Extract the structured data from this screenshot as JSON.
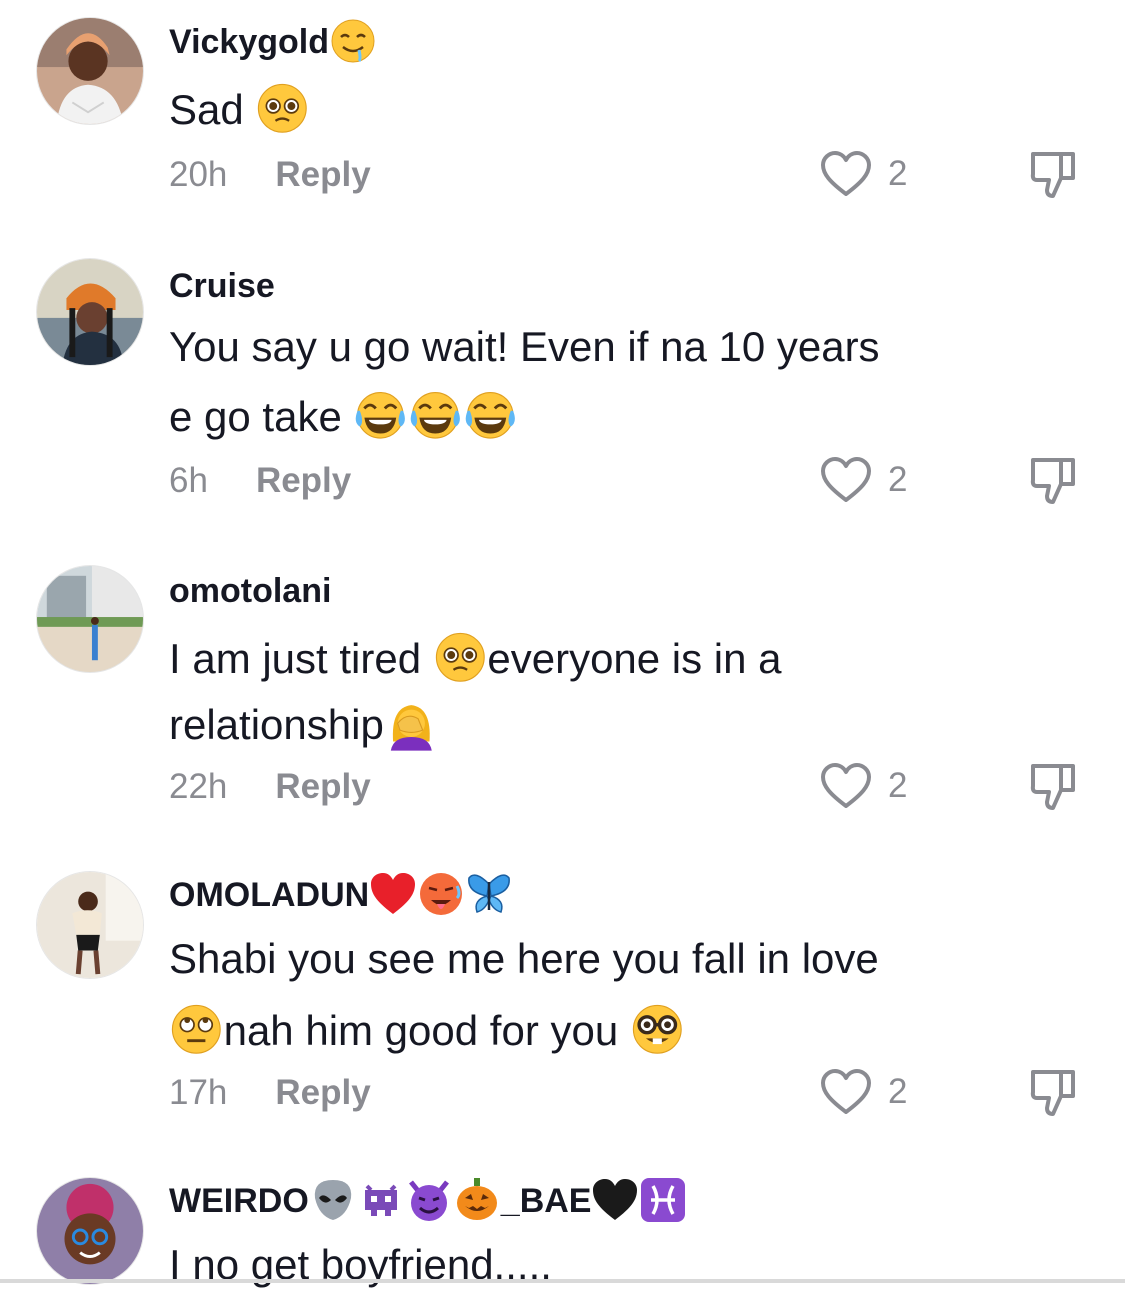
{
  "comments": [
    {
      "username": "Vickygold",
      "username_emojis": [
        "drooling-face"
      ],
      "text_parts": [
        "Sad "
      ],
      "text_emojis_after": [
        "pleading-face"
      ],
      "time": "20h",
      "reply_label": "Reply",
      "likes": "2"
    },
    {
      "username": "Cruise",
      "text_line1": "You say u go wait! Even if na 10 years",
      "text_line2": "e go take ",
      "text_emojis_after": [
        "tears-of-joy",
        "tears-of-joy",
        "tears-of-joy"
      ],
      "time": "6h",
      "reply_label": "Reply",
      "likes": "2"
    },
    {
      "username": "omotolani",
      "text_before": "I am just tired ",
      "text_after": "everyone is in a",
      "text_line2": "relationship",
      "emojis": [
        "pleading-face",
        "woman-facepalming"
      ],
      "time": "22h",
      "reply_label": "Reply",
      "likes": "2"
    },
    {
      "username": "OMOLADUN",
      "username_emojis": [
        "red-heart",
        "hot-face",
        "butterfly"
      ],
      "text_line1": "Shabi you see me here you fall in love",
      "text_line2a": "nah him good for you ",
      "emojis": [
        "rolling-eyes",
        "nerd-face"
      ],
      "time": "17h",
      "reply_label": "Reply",
      "likes": "2"
    },
    {
      "username_part1": "WEIRDO",
      "username_part2": "_BAE",
      "username_emojis": [
        "alien",
        "alien-monster",
        "smiling-devil",
        "jack-o-lantern",
        "black-heart",
        "pisces"
      ],
      "text_line1": "I no get boyfriend....."
    }
  ],
  "icons": {
    "like": "heart-outline-icon",
    "dislike": "thumbs-down-icon"
  },
  "colors": {
    "text": "#161823",
    "muted": "#8a8b91",
    "background": "#ffffff"
  }
}
